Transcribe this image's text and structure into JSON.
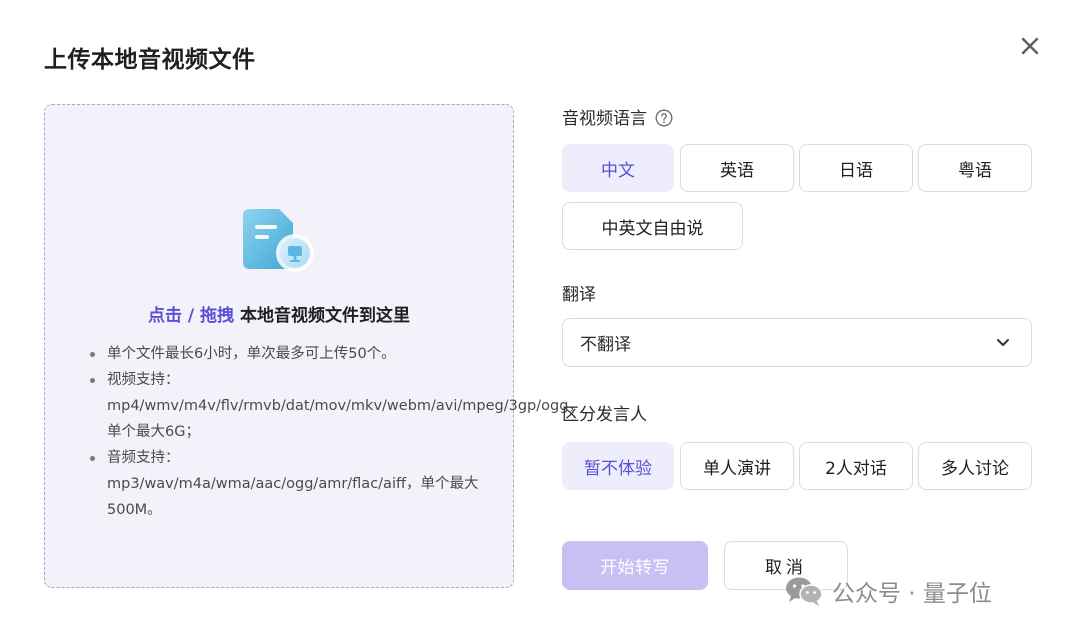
{
  "dialog": {
    "title": "上传本地音视频文件"
  },
  "upload": {
    "headline_action": "点击 / 拖拽",
    "headline_rest": " 本地音视频文件到这里",
    "notes": [
      "单个文件最长6小时，单次最多可上传50个。",
      "视频支持：mp4/wmv/m4v/flv/rmvb/dat/mov/mkv/webm/avi/mpeg/3gp/ogg，单个最大6G；",
      "音频支持：mp3/wav/m4a/wma/aac/ogg/amr/flac/aiff，单个最大500M。"
    ]
  },
  "language": {
    "label": "音视频语言",
    "options": [
      "中文",
      "英语",
      "日语",
      "粤语",
      "中英文自由说"
    ],
    "selected": "中文"
  },
  "translate": {
    "label": "翻译",
    "value": "不翻译"
  },
  "speaker": {
    "label": "区分发言人",
    "options": [
      "暂不体验",
      "单人演讲",
      "2人对话",
      "多人讨论"
    ],
    "selected": "暂不体验"
  },
  "actions": {
    "start": "开始转写",
    "cancel": "取消"
  },
  "watermark": {
    "text": "公众号 · 量子位"
  },
  "colors": {
    "accent": "#5b4fd6",
    "selected_bg": "#eeedfb",
    "dropzone_bg": "#f3f2fb",
    "primary_disabled": "#c6c0f3"
  },
  "icons": {
    "close": "close-icon",
    "help": "question-circle-icon",
    "chevron": "chevron-down-icon",
    "upload_illustration": "audio-file-icon",
    "watermark_logo": "wechat-icon"
  }
}
